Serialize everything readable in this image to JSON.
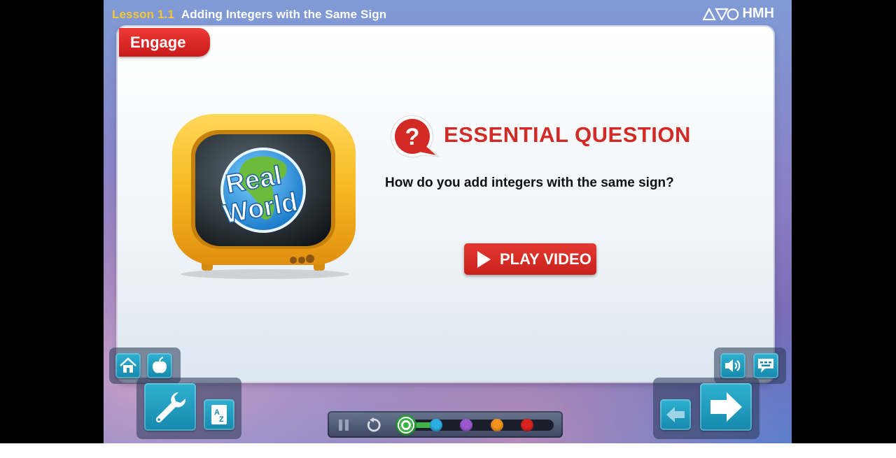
{
  "header": {
    "lesson_label": "Lesson 1.1",
    "lesson_title": "Adding Integers with the Same Sign",
    "logo_text": "HMH"
  },
  "section_tab": "Engage",
  "tv": {
    "line1": "Real",
    "line2": "World"
  },
  "essential_question": {
    "title": "ESSENTIAL QUESTION",
    "question": "How do you add integers with the same sign?"
  },
  "play_button": {
    "label": "PLAY VIDEO"
  },
  "toolbar_left": {
    "home": "home-icon",
    "teacher": "apple-icon",
    "tools": "wrench-icon",
    "glossary": "glossary-icon"
  },
  "toolbar_right": {
    "audio": "speaker-icon",
    "captions": "captions-icon",
    "back": "arrow-left-icon",
    "next": "arrow-right-icon"
  },
  "media_bar": {
    "pause": "pause-icon",
    "replay": "replay-icon",
    "progress_steps": [
      {
        "color": "#3db34a",
        "current": true
      },
      {
        "color": "#2aaee0",
        "current": false
      },
      {
        "color": "#9b59d0",
        "current": false
      },
      {
        "color": "#f5921e",
        "current": false
      },
      {
        "color": "#d9231f",
        "current": false
      }
    ]
  },
  "colors": {
    "accent_red": "#d22b25",
    "lesson_yellow": "#f6c735",
    "button_teal": "#1f9ec3"
  }
}
